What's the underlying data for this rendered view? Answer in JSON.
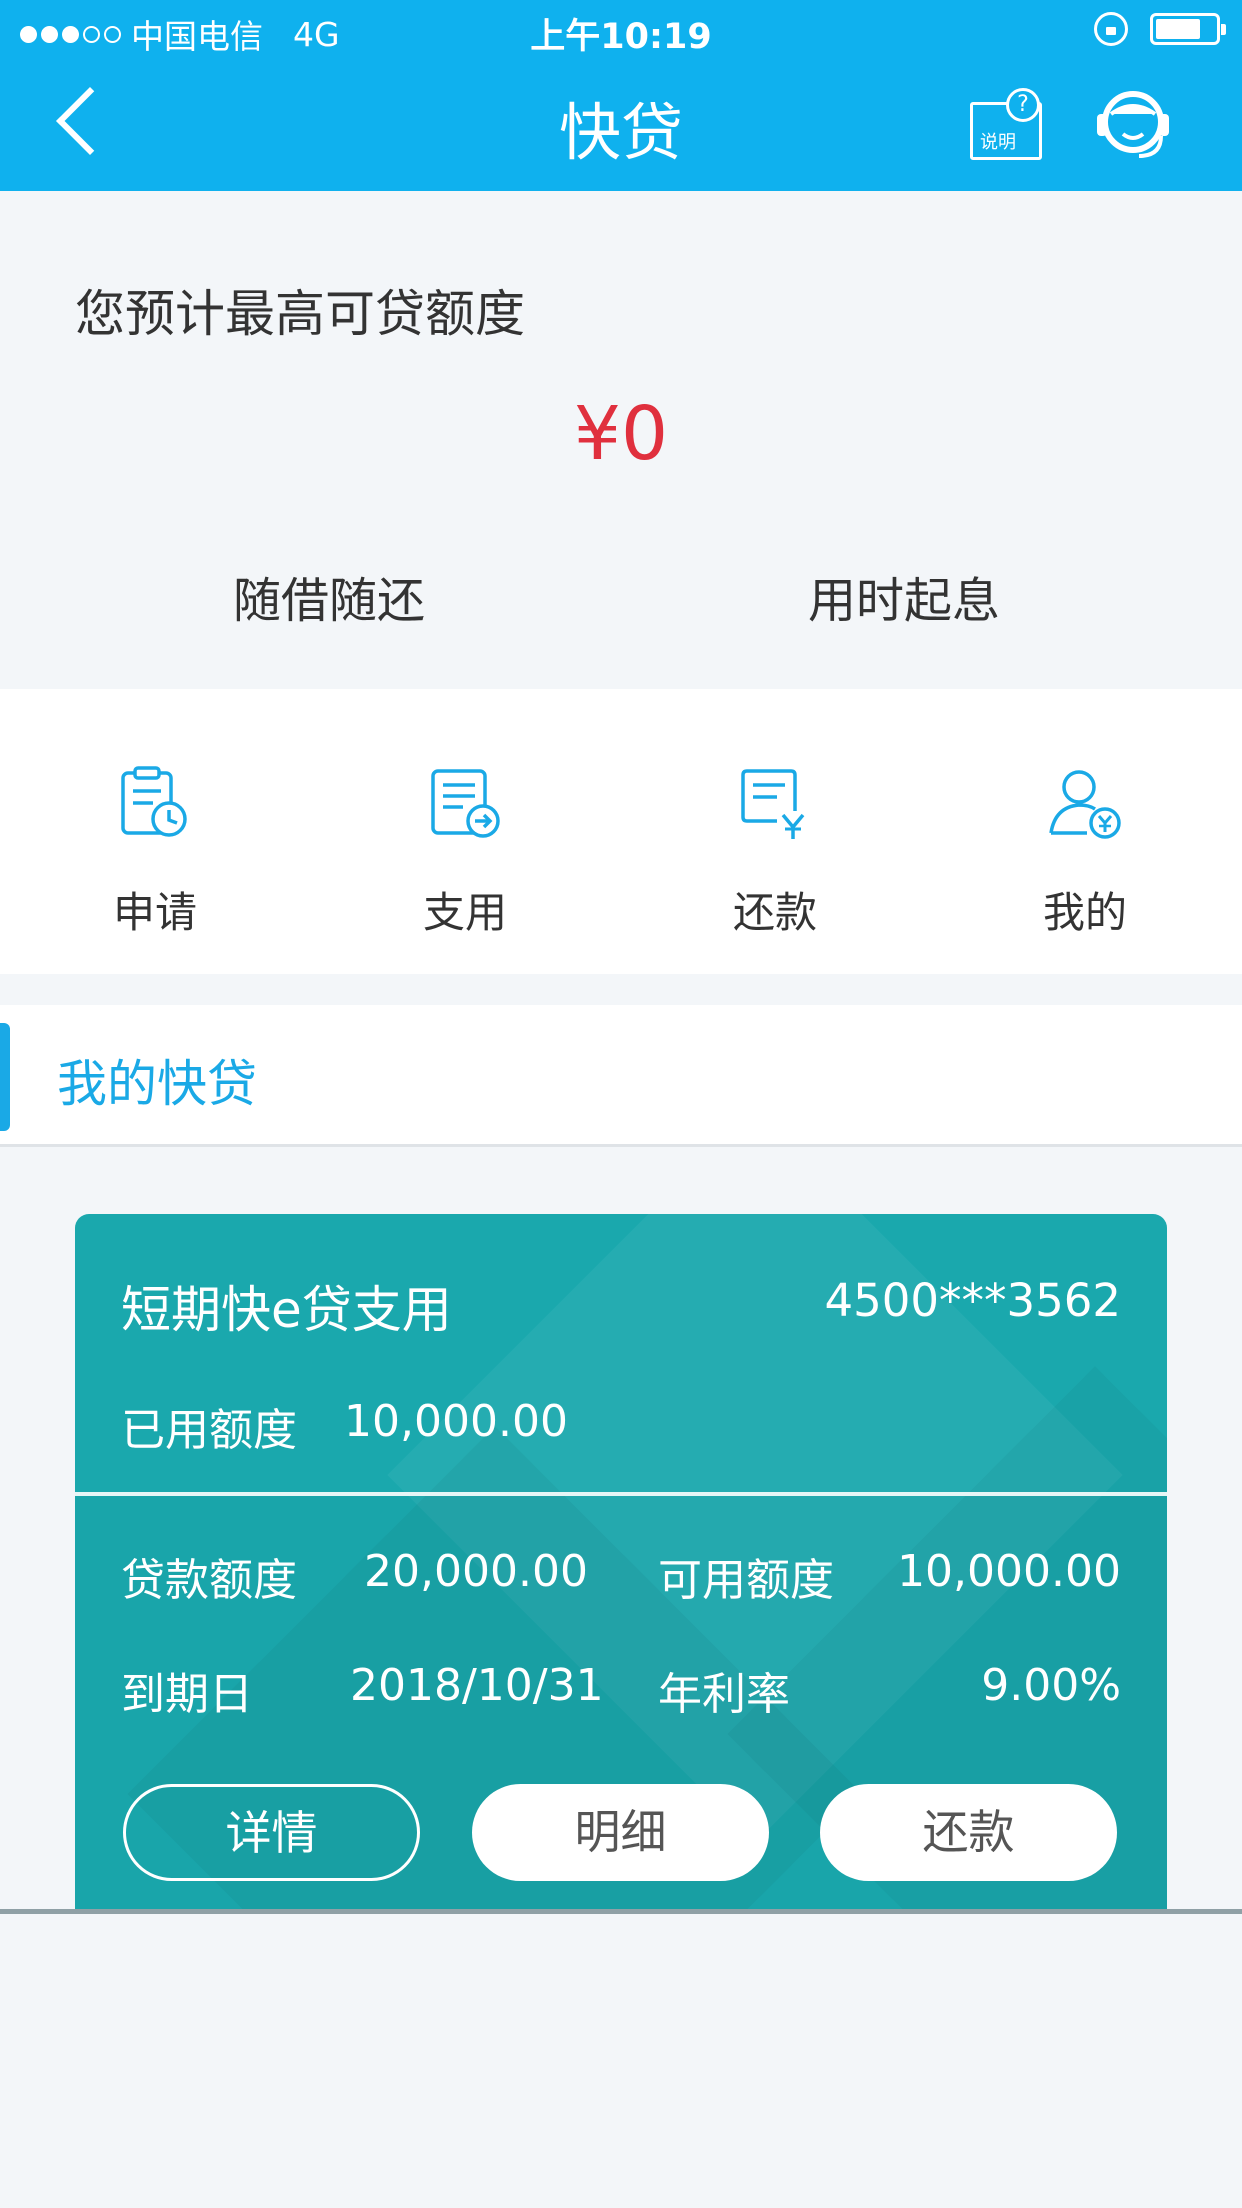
{
  "status_bar": {
    "signal_dots_filled": 3,
    "signal_dots_total": 5,
    "carrier": "中国电信",
    "network": "4G",
    "time": "上午10:19",
    "battery_level_percent": 70
  },
  "nav": {
    "title": "快贷",
    "help_label": "说明",
    "help_glyph": "?",
    "back_icon": "chevron-left-icon",
    "help_icon": "help-document-icon",
    "service_icon": "customer-service-icon"
  },
  "quota": {
    "label": "您预计最高可贷额度",
    "value": "¥0",
    "features": [
      "随借随还",
      "用时起息"
    ]
  },
  "actions": [
    {
      "label": "申请",
      "icon": "apply-clock-icon"
    },
    {
      "label": "支用",
      "icon": "withdraw-arrow-icon"
    },
    {
      "label": "还款",
      "icon": "repay-yen-icon"
    },
    {
      "label": "我的",
      "icon": "user-yen-icon"
    }
  ],
  "my_loans": {
    "title": "我的快贷"
  },
  "loan_card": {
    "name": "短期快e贷支用",
    "account": "4500***3562",
    "used_label": "已用额度",
    "used_value": "10,000.00",
    "limit_label": "贷款额度",
    "limit_value": "20,000.00",
    "available_label": "可用额度",
    "available_value": "10,000.00",
    "due_label": "到期日",
    "due_value": "2018/10/31",
    "rate_label": "年利率",
    "rate_value": "9.00%",
    "buttons": {
      "detail": "详情",
      "statement": "明细",
      "repay": "还款"
    }
  },
  "colors": {
    "primary_blue": "#0fb1ee",
    "accent_blue": "#1aa9e6",
    "amount_red": "#e0303e",
    "card_teal": "#1aa8ad",
    "background": "#f3f6f9"
  }
}
